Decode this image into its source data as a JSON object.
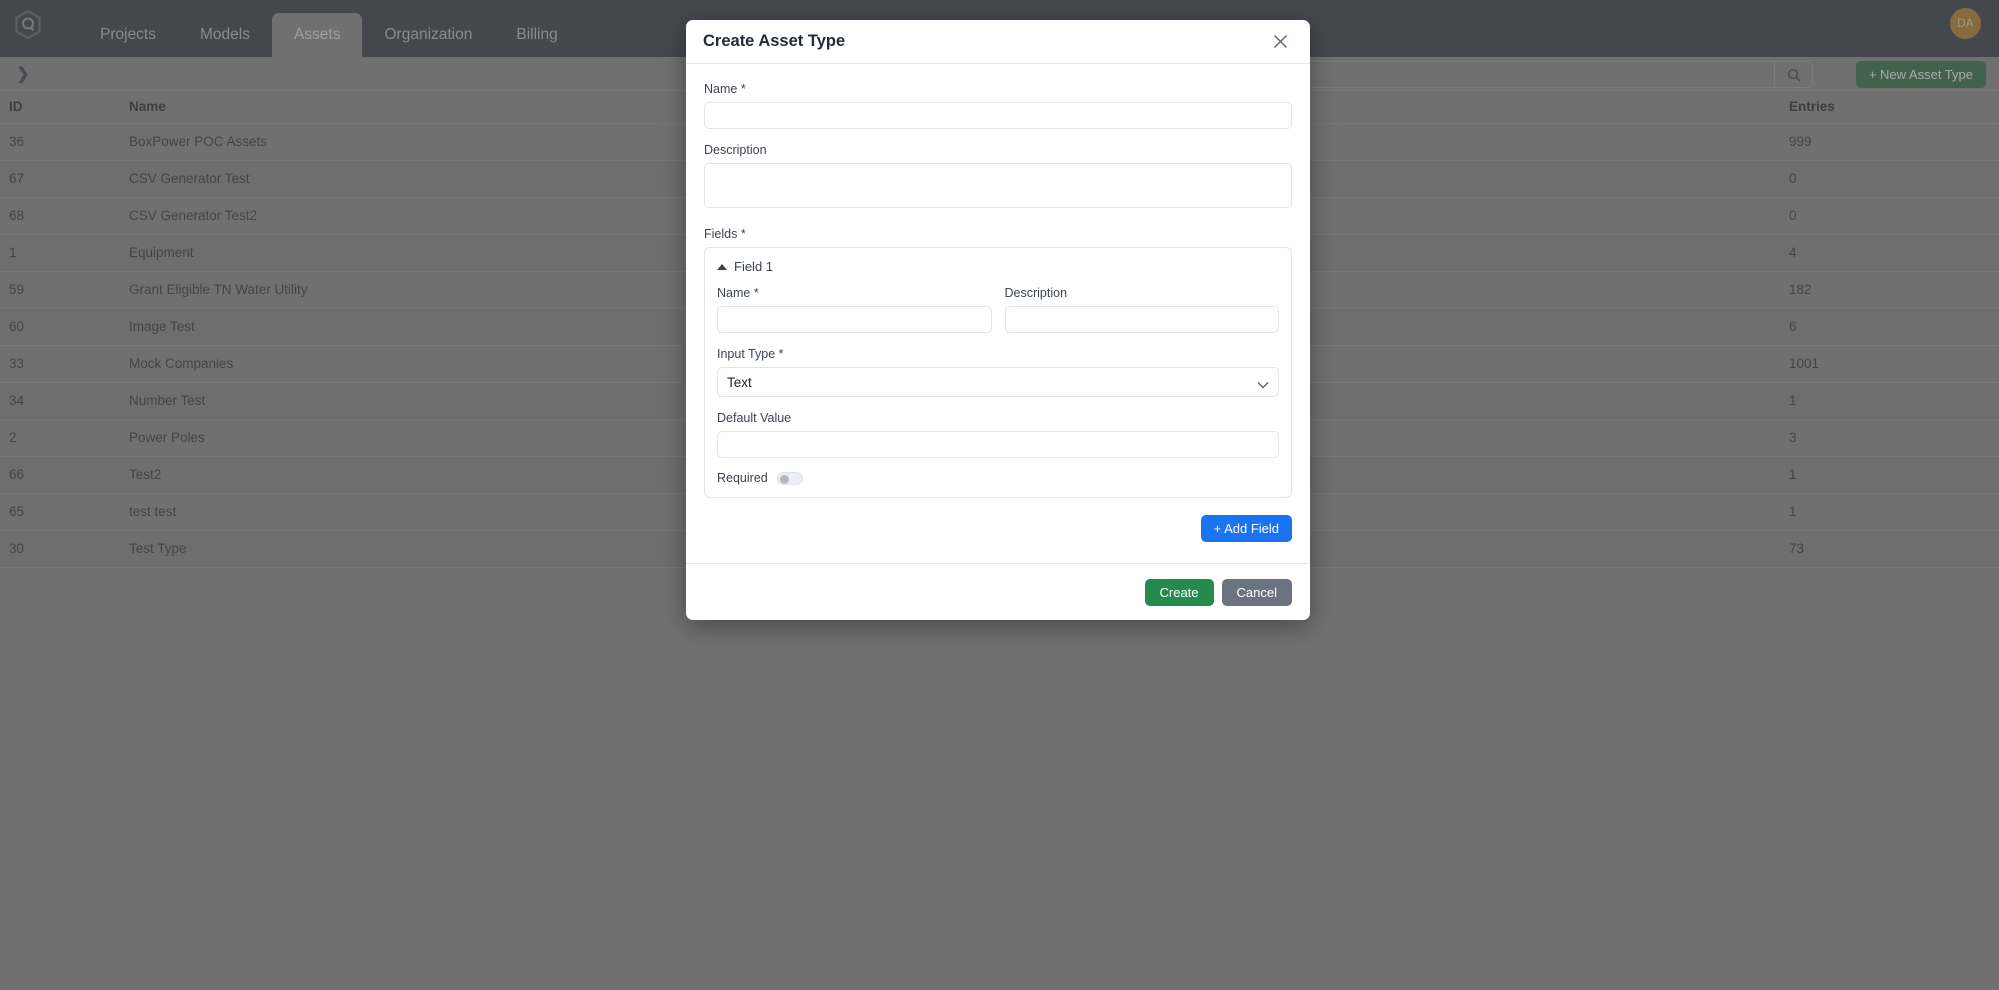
{
  "app": {
    "logo_icon": "hexagon-q-logo",
    "nav_tabs": [
      {
        "label": "Projects",
        "active": false
      },
      {
        "label": "Models",
        "active": false
      },
      {
        "label": "Assets",
        "active": true
      },
      {
        "label": "Organization",
        "active": false
      },
      {
        "label": "Billing",
        "active": false
      }
    ],
    "avatar_initials": "DA",
    "avatar_color": "#b8790d"
  },
  "toolbar": {
    "expand_icon": "chevron-right-icon",
    "search_value": "",
    "search_placeholder": "",
    "search_icon": "search-icon",
    "new_asset_label": "+ New Asset Type",
    "new_asset_color": "#1d6435"
  },
  "table": {
    "columns": [
      "ID",
      "Name",
      "Entries"
    ],
    "rows": [
      {
        "id": "36",
        "name": "BoxPower POC Assets",
        "entries": "999"
      },
      {
        "id": "67",
        "name": "CSV Generator Test",
        "entries": "0"
      },
      {
        "id": "68",
        "name": "CSV Generator Test2",
        "entries": "0"
      },
      {
        "id": "1",
        "name": "Equipment",
        "entries": "4"
      },
      {
        "id": "59",
        "name": "Grant Eligible TN Water Utility",
        "entries": "182"
      },
      {
        "id": "60",
        "name": "Image Test",
        "entries": "6"
      },
      {
        "id": "33",
        "name": "Mock Companies",
        "entries": "1001"
      },
      {
        "id": "34",
        "name": "Number Test",
        "entries": "1"
      },
      {
        "id": "2",
        "name": "Power Poles",
        "entries": "3"
      },
      {
        "id": "66",
        "name": "Test2",
        "entries": "1"
      },
      {
        "id": "65",
        "name": "test test",
        "entries": "1"
      },
      {
        "id": "30",
        "name": "Test Type",
        "entries": "73"
      }
    ]
  },
  "modal": {
    "title": "Create Asset Type",
    "close_icon": "close-icon",
    "name_label": "Name *",
    "name_value": "",
    "description_label": "Description",
    "description_value": "",
    "fields_label": "Fields *",
    "field": {
      "collapse_icon": "triangle-up-icon",
      "header": "Field 1",
      "name_label": "Name *",
      "name_value": "",
      "description_label": "Description",
      "description_value": "",
      "input_type_label": "Input Type *",
      "input_type_value": "Text",
      "input_type_chevron": "chevron-down-icon",
      "default_value_label": "Default Value",
      "default_value": "",
      "required_label": "Required",
      "required_on": false
    },
    "add_field_label": "+ Add Field",
    "add_field_color": "#1a73f0",
    "create_label": "Create",
    "create_color": "#238b4c",
    "cancel_label": "Cancel",
    "cancel_color": "#6b7280"
  }
}
